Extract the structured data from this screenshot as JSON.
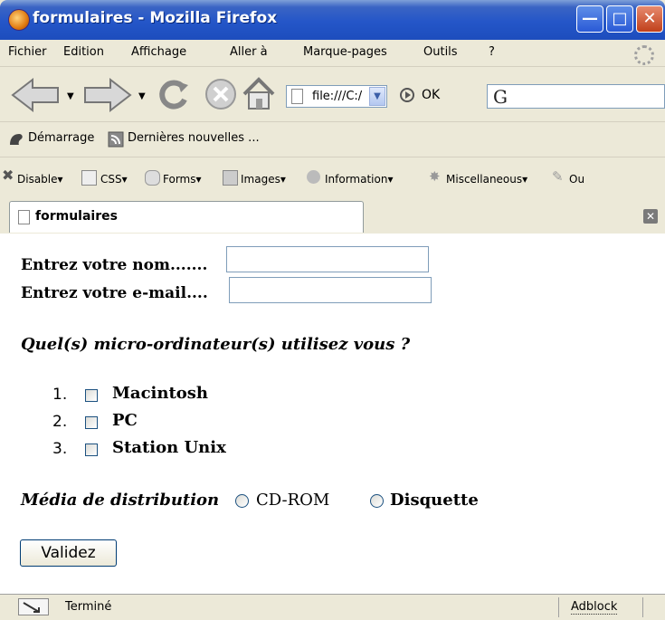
{
  "window": {
    "title": "formulaires - Mozilla Firefox"
  },
  "menu": {
    "items": [
      "Fichier",
      "Edition",
      "Affichage",
      "Aller à",
      "Marque-pages",
      "Outils",
      "?"
    ]
  },
  "navigation": {
    "url": "file:///C:/",
    "go_label": "OK",
    "search_engine_icon": "G"
  },
  "bookmarks": {
    "items": [
      "Démarrage",
      "Dernières nouvelles ..."
    ]
  },
  "webdev_toolbar": {
    "items": [
      "Disable",
      "CSS",
      "Forms",
      "Images",
      "Information",
      "Miscellaneous",
      "Ou"
    ]
  },
  "tab": {
    "label": "formulaires"
  },
  "form": {
    "name_label": "Entrez votre nom.......",
    "name_value": "",
    "email_label": "Entrez votre e-mail....",
    "email_value": "",
    "question": "Quel(s) micro-ordinateur(s) utilisez vous ?",
    "computers": [
      {
        "number": "1.",
        "label": "Macintosh",
        "checked": false
      },
      {
        "number": "2.",
        "label": "PC",
        "checked": false
      },
      {
        "number": "3.",
        "label": "Station Unix",
        "checked": false
      }
    ],
    "media_label": "Média de distribution",
    "media_options": [
      {
        "label": "CD-ROM",
        "selected": false
      },
      {
        "label": "Disquette",
        "selected": false
      }
    ],
    "submit_label": "Validez"
  },
  "status": {
    "text": "Terminé",
    "adblock": "Adblock"
  }
}
